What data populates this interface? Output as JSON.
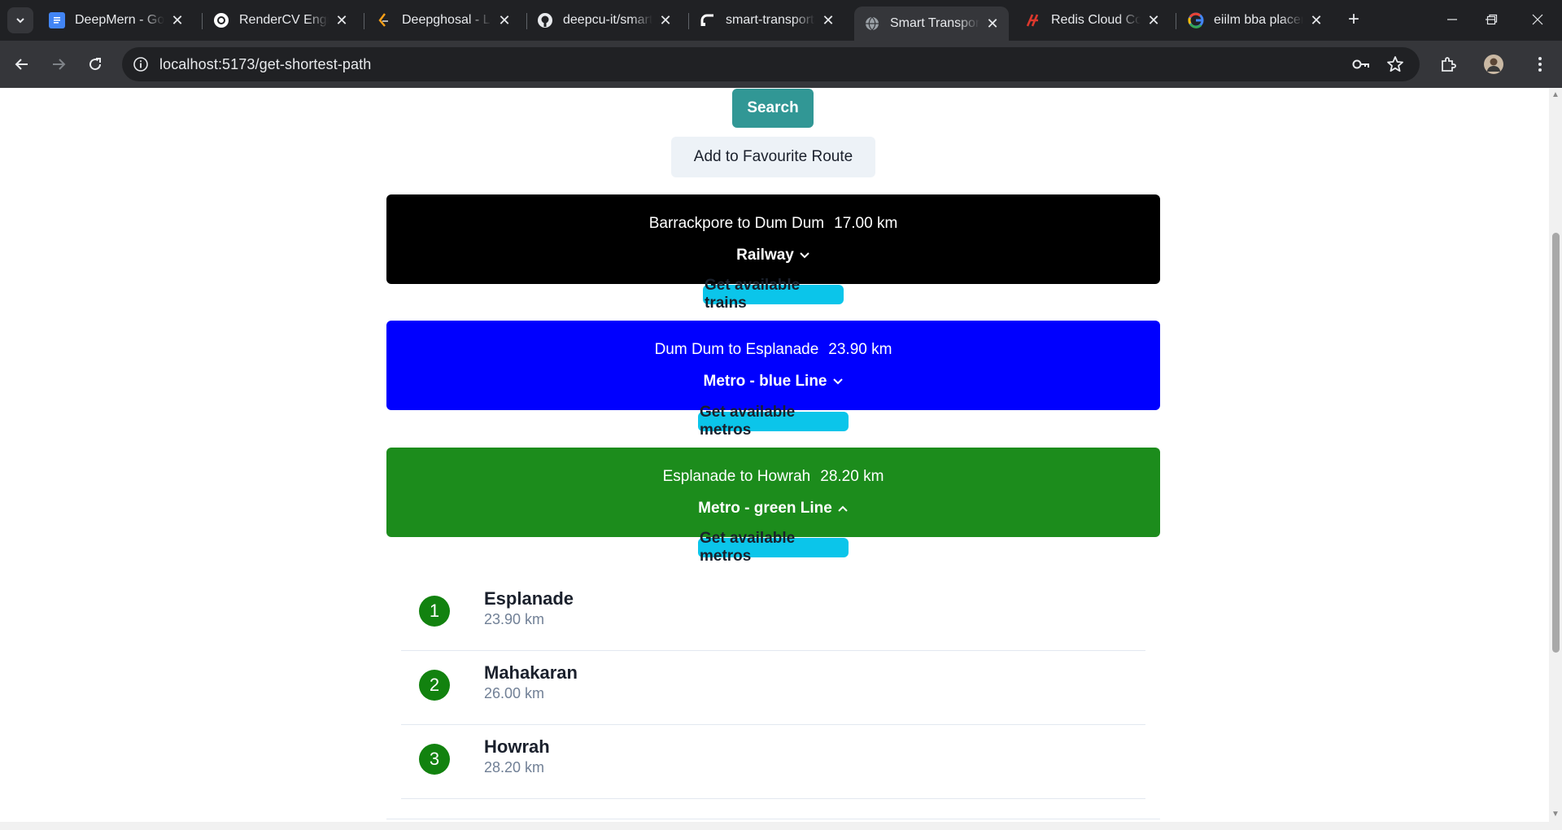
{
  "browser": {
    "tabs": [
      {
        "title": "DeepMern - Google Docs",
        "icon": "google-docs-icon",
        "active": false
      },
      {
        "title": "RenderCV Engine",
        "icon": "rendercv-icon",
        "active": false
      },
      {
        "title": "Deepghosal - LeetCode",
        "icon": "leetcode-icon",
        "active": false
      },
      {
        "title": "deepcu-it/smart-transportation",
        "icon": "github-icon",
        "active": false
      },
      {
        "title": "smart-transportation",
        "icon": "render-icon",
        "active": false
      },
      {
        "title": "Smart Transportation",
        "icon": "globe-icon",
        "active": true
      },
      {
        "title": "Redis Cloud Console",
        "icon": "redis-icon",
        "active": false
      },
      {
        "title": "eiilm bba placement",
        "icon": "google-icon",
        "active": false
      }
    ],
    "url": "localhost:5173/get-shortest-path"
  },
  "page": {
    "search_label": "Search",
    "favourite_label": "Add to Favourite Route",
    "segments": [
      {
        "route": "Barrackpore to Dum Dum",
        "distance": "17.00 km",
        "mode": "Railway",
        "color": "#000000",
        "expanded": false,
        "action": "Get available trains"
      },
      {
        "route": "Dum Dum to Esplanade",
        "distance": "23.90 km",
        "mode": "Metro - blue Line",
        "color": "#0000ff",
        "expanded": false,
        "action": "Get available metros"
      },
      {
        "route": "Esplanade to Howrah",
        "distance": "28.20 km",
        "mode": "Metro - green Line",
        "color": "#1c8c1c",
        "expanded": true,
        "action": "Get available metros"
      }
    ],
    "stops": [
      {
        "index": "1",
        "name": "Esplanade",
        "distance": "23.90 km"
      },
      {
        "index": "2",
        "name": "Mahakaran",
        "distance": "26.00 km"
      },
      {
        "index": "3",
        "name": "Howrah",
        "distance": "28.20 km"
      }
    ]
  }
}
